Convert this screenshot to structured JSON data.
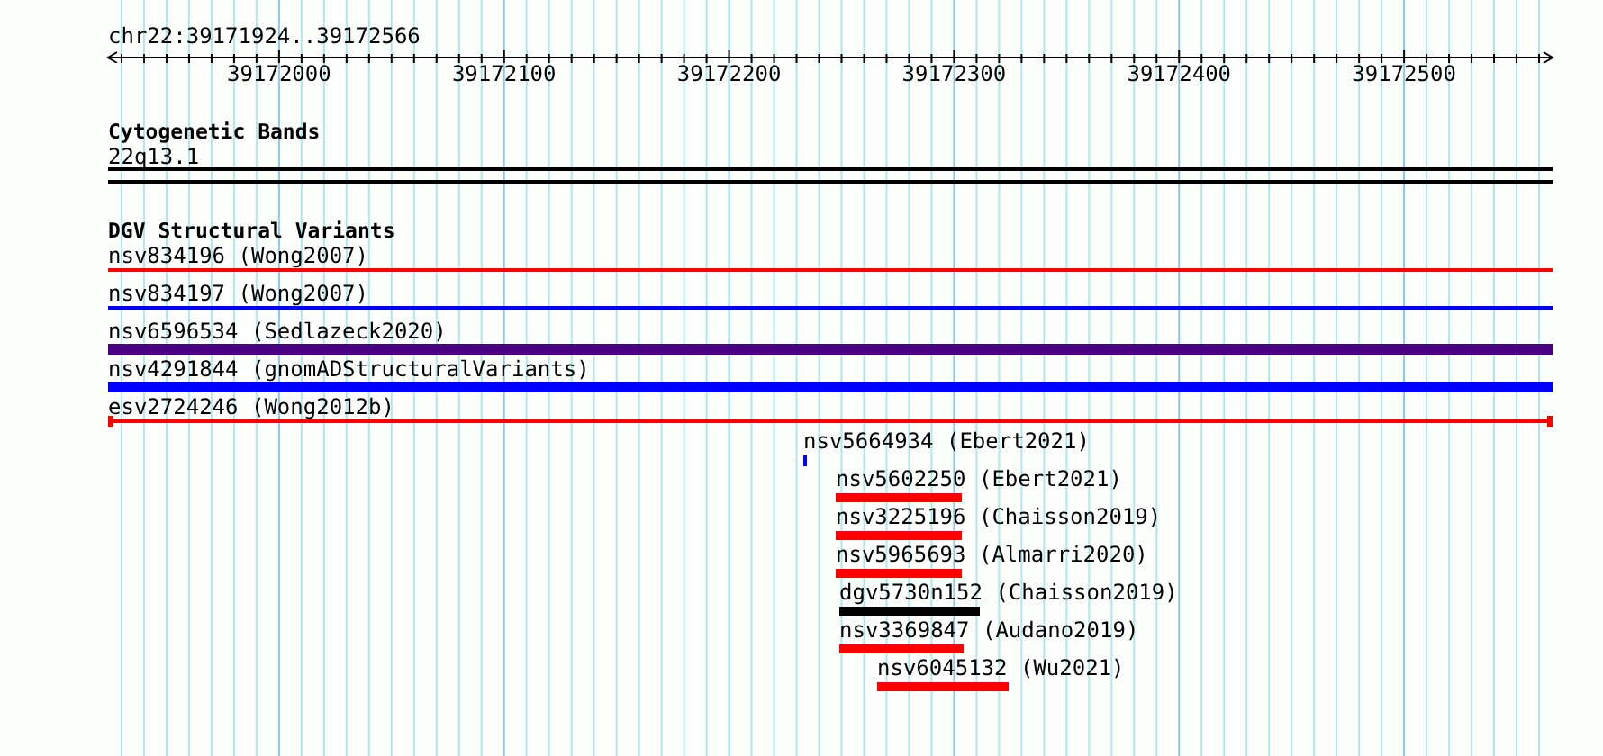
{
  "ruler": {
    "location": "chr22:39171924..39172566",
    "ticks": [
      "39172000",
      "39172100",
      "39172200",
      "39172300",
      "39172400",
      "39172500"
    ]
  },
  "tracks": [
    {
      "title": "Cytogenetic Bands",
      "features": [
        {
          "label": "22q13.1",
          "kind": "band",
          "color": "#000000"
        }
      ]
    },
    {
      "title": "DGV Structural Variants",
      "features": [
        {
          "label": "nsv834196 (Wong2007)",
          "kind": "line",
          "color": "#ff0000"
        },
        {
          "label": "nsv834197 (Wong2007)",
          "kind": "line",
          "color": "#0000ff"
        },
        {
          "label": "nsv6596534 (Sedlazeck2020)",
          "kind": "bar",
          "color": "#4b0082"
        },
        {
          "label": "nsv4291844 (gnomADStructuralVariants)",
          "kind": "bar",
          "color": "#0000ff"
        },
        {
          "label": "esv2724246 (Wong2012b)",
          "kind": "clipped",
          "color": "#ff0000"
        },
        {
          "label": "nsv5664934 (Ebert2021)",
          "kind": "block",
          "color": "#0000ff"
        },
        {
          "label": "nsv5602250 (Ebert2021)",
          "kind": "block",
          "color": "#ff0000"
        },
        {
          "label": "nsv3225196 (Chaisson2019)",
          "kind": "block",
          "color": "#ff0000"
        },
        {
          "label": "nsv5965693 (Almarri2020)",
          "kind": "block",
          "color": "#ff0000"
        },
        {
          "label": "dgv5730n152 (Chaisson2019)",
          "kind": "block",
          "color": "#000000"
        },
        {
          "label": "nsv3369847 (Audano2019)",
          "kind": "block",
          "color": "#ff0000"
        },
        {
          "label": "nsv6045132 (Wu2021)",
          "kind": "block",
          "color": "#ff0000"
        }
      ]
    }
  ]
}
